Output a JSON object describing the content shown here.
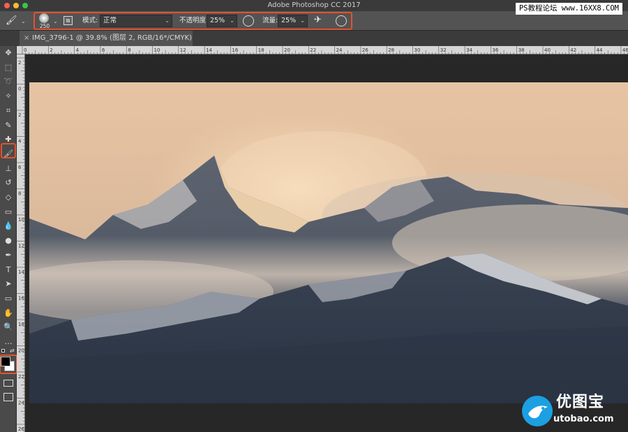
{
  "app": {
    "title": "Adobe Photoshop CC 2017",
    "watermark_top": "PS教程论坛 www.16XX8.COM"
  },
  "colors": {
    "highlight": "#e2532d",
    "close": "#fc5f57",
    "minimize": "#fdbc2f",
    "maximize": "#34c84a"
  },
  "options_bar": {
    "brush_size": "250",
    "mode_label": "模式:",
    "mode_value": "正常",
    "opacity_label": "不透明度:",
    "opacity_value": "25%",
    "flow_label": "流量:",
    "flow_value": "25%"
  },
  "document_tab": {
    "close_glyph": "×",
    "title": "IMG_3796-1 @ 39.8% (图层 2, RGB/16*/CMYK) *"
  },
  "ruler_top": [
    "0",
    "2",
    "4",
    "6",
    "8",
    "10",
    "12",
    "14",
    "16",
    "18",
    "20",
    "22",
    "24",
    "26",
    "28",
    "30",
    "32",
    "34",
    "36",
    "38",
    "40",
    "42",
    "44",
    "46"
  ],
  "ruler_left": [
    "2",
    "0",
    "2",
    "4",
    "6",
    "8",
    "1\n0",
    "1\n2",
    "1\n4",
    "1\n6",
    "1\n8",
    "2\n0",
    "2\n2",
    "2\n4",
    "2\n6"
  ],
  "tools": [
    {
      "name": "move-tool-icon",
      "glyph": "✥"
    },
    {
      "name": "marquee-tool-icon",
      "glyph": "⬚"
    },
    {
      "name": "lasso-tool-icon",
      "glyph": "➰"
    },
    {
      "name": "magic-wand-tool-icon",
      "glyph": "✧"
    },
    {
      "name": "crop-tool-icon",
      "glyph": "⌗"
    },
    {
      "name": "eyedropper-tool-icon",
      "glyph": "✎"
    },
    {
      "name": "healing-brush-tool-icon",
      "glyph": "✚"
    },
    {
      "name": "brush-tool-icon",
      "glyph": "🖌"
    },
    {
      "name": "clone-stamp-tool-icon",
      "glyph": "⊥"
    },
    {
      "name": "history-brush-tool-icon",
      "glyph": "↺"
    },
    {
      "name": "eraser-tool-icon",
      "glyph": "◇"
    },
    {
      "name": "gradient-tool-icon",
      "glyph": "▭"
    },
    {
      "name": "blur-tool-icon",
      "glyph": "💧"
    },
    {
      "name": "dodge-tool-icon",
      "glyph": "●"
    },
    {
      "name": "pen-tool-icon",
      "glyph": "✒"
    },
    {
      "name": "type-tool-icon",
      "glyph": "T"
    },
    {
      "name": "path-selection-tool-icon",
      "glyph": "➤"
    },
    {
      "name": "rectangle-tool-icon",
      "glyph": "▭"
    },
    {
      "name": "hand-tool-icon",
      "glyph": "✋"
    },
    {
      "name": "zoom-tool-icon",
      "glyph": "🔍"
    },
    {
      "name": "more-tools-icon",
      "glyph": "…"
    }
  ],
  "logo": {
    "text": "优图宝",
    "url": "utobao.com"
  }
}
